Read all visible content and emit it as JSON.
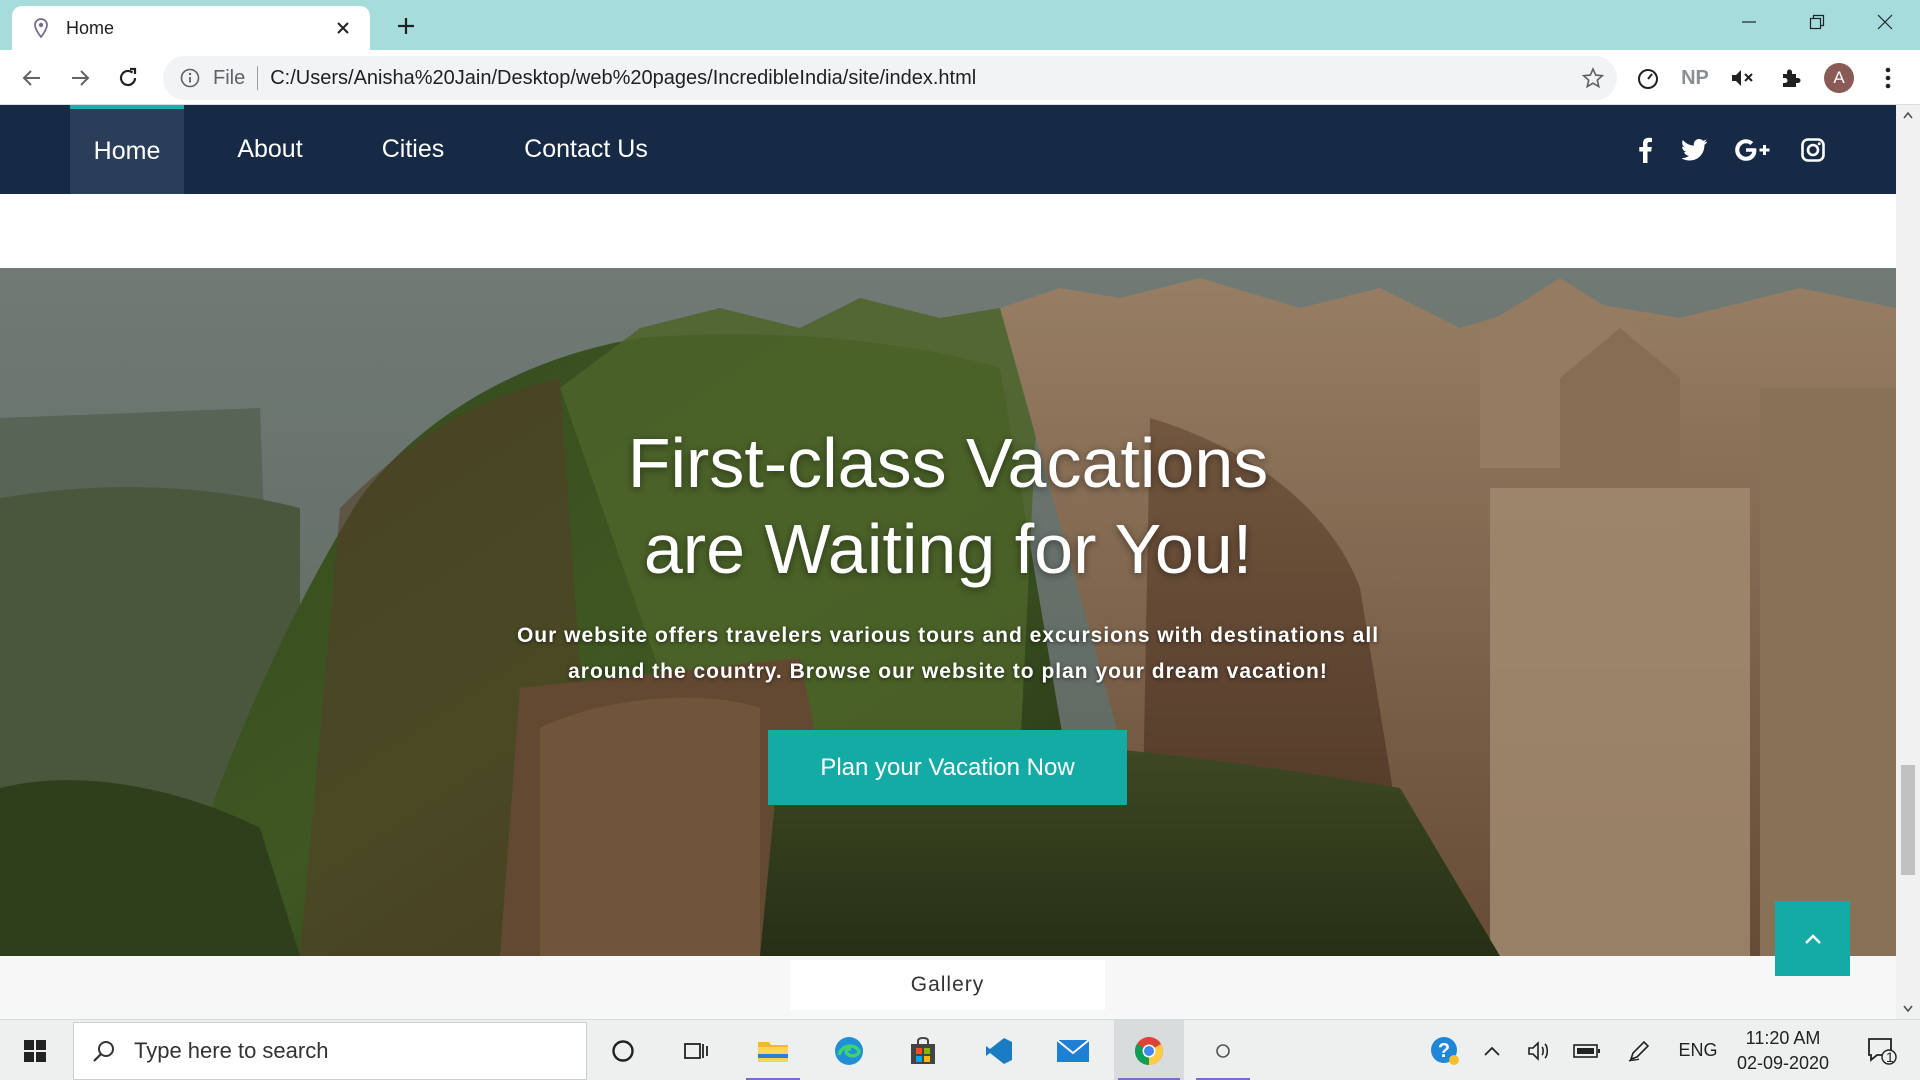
{
  "browser": {
    "tab_title": "Home",
    "address_prefix": "File",
    "url": "C:/Users/Anisha%20Jain/Desktop/web%20pages/IncredibleIndia/site/index.html",
    "extension_np": "NP",
    "profile_initial": "A"
  },
  "site": {
    "nav": [
      {
        "label": "Home",
        "active": true
      },
      {
        "label": "About",
        "active": false
      },
      {
        "label": "Cities",
        "active": false
      },
      {
        "label": "Contact Us",
        "active": false
      }
    ],
    "social": [
      "facebook-icon",
      "twitter-icon",
      "google-plus-icon",
      "instagram-icon"
    ],
    "hero": {
      "title_line1": "First-class Vacations",
      "title_line2": "are Waiting for You!",
      "text_line1": "Our website offers travelers various tours and excursions with destinations all",
      "text_line2": "around the country. Browse our website to plan your dream vacation!",
      "cta_label": "Plan your Vacation Now"
    },
    "gallery_label": "Gallery"
  },
  "taskbar": {
    "search_placeholder": "Type here to search",
    "language": "ENG",
    "time": "11:20 AM",
    "date": "02-09-2020",
    "notification_count": "1"
  },
  "colors": {
    "nav_bg": "#172a45",
    "accent": "#15aba5",
    "tabstrip": "#a6dcdc"
  }
}
